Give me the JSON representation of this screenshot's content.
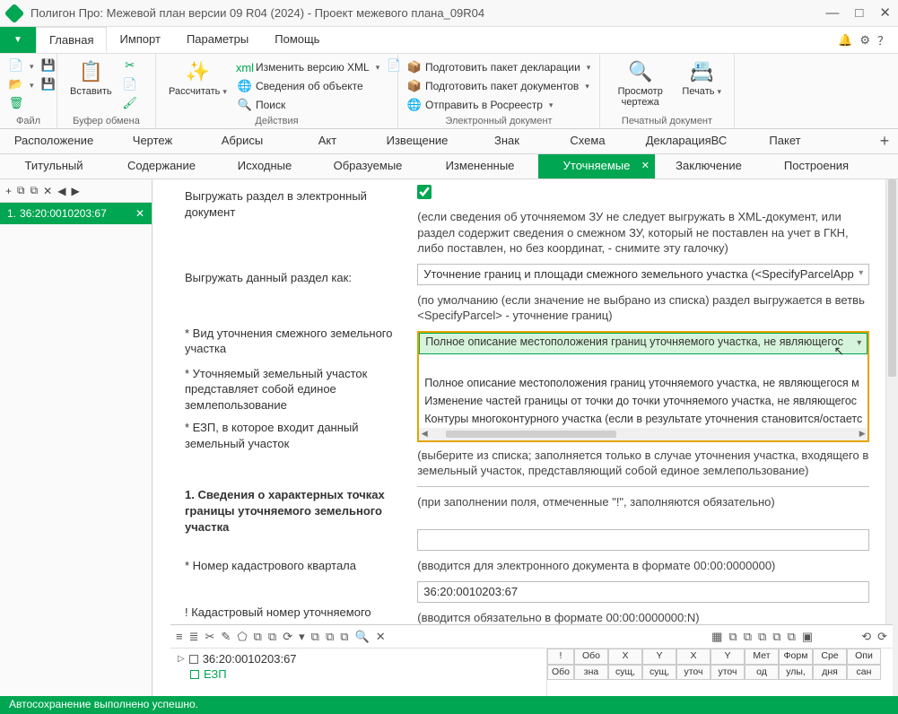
{
  "window": {
    "title": "Полигон Про: Межевой план версии 09 R04 (2024) - Проект межевого плана_09R04"
  },
  "menu": {
    "tabs": [
      "Главная",
      "Импорт",
      "Параметры",
      "Помощь"
    ]
  },
  "ribbon": {
    "file": {
      "label": "Файл"
    },
    "clipboard": {
      "label": "Буфер обмена",
      "paste": "Вставить"
    },
    "actions": {
      "label": "Действия",
      "calc": "Рассчитать",
      "xml": "Изменить версию XML",
      "obj": "Сведения об объекте",
      "search": "Поиск"
    },
    "edoc": {
      "label": "Электронный документ",
      "decl": "Подготовить пакет декларации",
      "docs": "Подготовить пакет документов",
      "send": "Отправить в Росреестр"
    },
    "print": {
      "label": "Печатный документ",
      "preview": "Просмотр чертежа",
      "print": "Печать"
    }
  },
  "sections_row1": [
    "Расположение",
    "Чертеж",
    "Абрисы",
    "Акт",
    "Извещение",
    "Знак",
    "Схема",
    "ДекларацияВС",
    "Пакет"
  ],
  "sections_row2": [
    "Титульный",
    "Содержание",
    "Исходные",
    "Образуемые",
    "Измененные",
    "Уточняемые",
    "Заключение",
    "Построения"
  ],
  "sidebar": {
    "item_no": "1.",
    "item_cad": "36:20:0010203:67"
  },
  "form": {
    "l_export": "Выгружать раздел в электронный документ",
    "h_export": "(если сведения об уточняемом ЗУ не следует выгружать в XML-документ, или раздел содержит сведения о смежном ЗУ, который не поставлен на учет в ГКН, либо поставлен, но без координат, - снимите эту галочку)",
    "l_exportas": "Выгружать данный раздел как:",
    "sel_exportas": "Уточнение границ и площади смежного земельного участка (<SpecifyParcelApp",
    "h_exportas": "(по умолчанию (если значение не выбрано из списка) раздел выгружается в ветвь <SpecifyParcel> - уточнение границ)",
    "l_vid": "* Вид уточнения смежного земельного участка",
    "l_edin": "* Уточняемый земельный участок представляет собой единое землепользование",
    "l_ezp": "* ЕЗП, в которое входит данный земельный участок",
    "h_ezp": "(выберите из списка; заполняется только в случае уточнения участка, входящего в земельный участок, представляющий собой единое землепользование)",
    "sec1": "1. Сведения о характерных точках границы уточняемого земельного участка",
    "h_sec1": "(при заполнении поля, отмеченные \"!\", заполняются обязательно)",
    "l_kvartal": "* Номер кадастрового квартала",
    "h_kvartal": "(вводится для электронного документа в формате 00:00:0000000)",
    "l_cad": "! Кадастровый номер уточняемого земельного участка",
    "v_cad": "36:20:0010203:67",
    "h_cad": "(вводится обязательно в формате 00:00:0000000:N)",
    "dd_sel": "Полное описание местоположения границ уточняемого участка, не являющегос",
    "dd_opt1": "Полное описание местоположения границ уточняемого участка, не являющегося м",
    "dd_opt2": "Изменение частей границы от точки до точки уточняемого участка, не являющегос",
    "dd_opt3": "Контуры многоконтурного участка (если в результате уточнения становится/остаетс"
  },
  "gridtree": {
    "node1": "36:20:0010203:67",
    "node2": "ЕЗП"
  },
  "gridhead": [
    "!",
    "Обо",
    "X",
    "Y",
    "X",
    "Y",
    "Мет",
    "Форм",
    "Сре",
    "Опи",
    "Обо",
    "зна",
    "сущ,",
    "сущ,",
    "уточ",
    "уточ",
    "од",
    "улы,",
    "дня",
    "сан"
  ],
  "status": {
    "msg": "Автосохранение выполнено успешно."
  }
}
